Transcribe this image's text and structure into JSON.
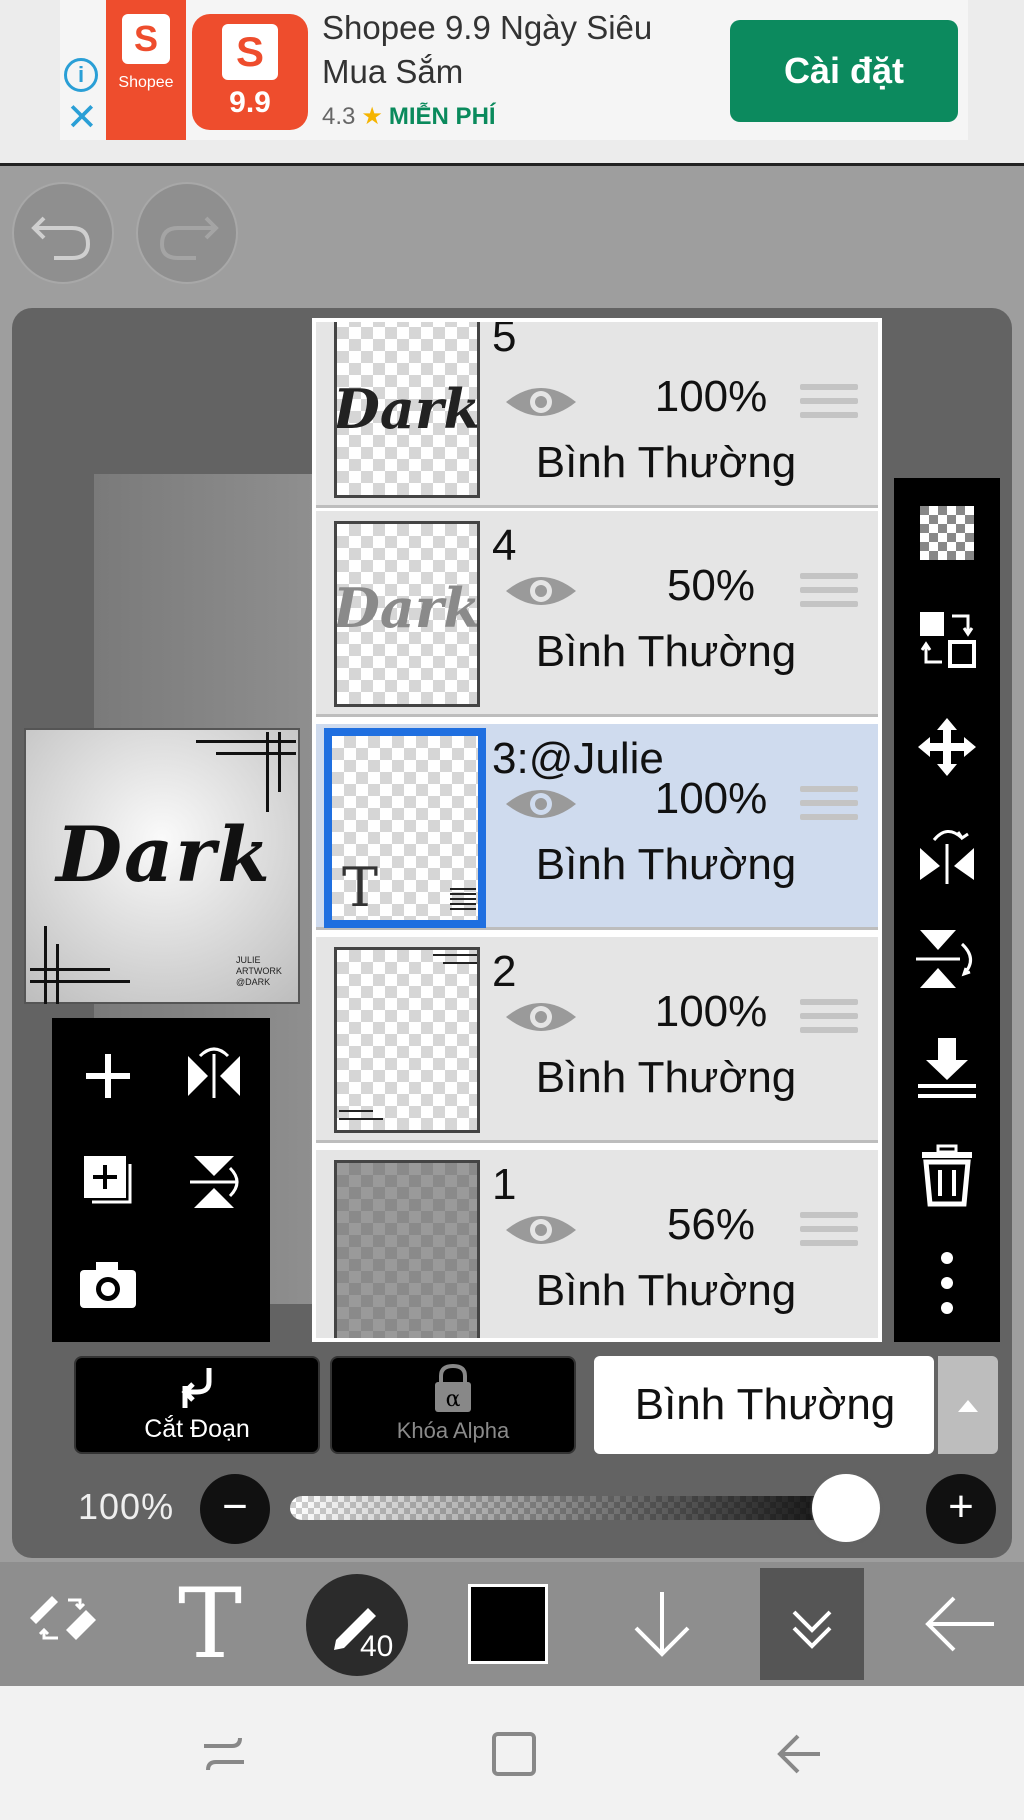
{
  "ad": {
    "app_logo_text": "Shopee",
    "sale_badge": "9.9",
    "title": "Shopee 9.9 Ngày Siêu Mua Sắm",
    "rating": "4.3",
    "price": "MIỄN PHÍ",
    "install_label": "Cài đặt"
  },
  "preview": {
    "art_text": "Dark",
    "credit_lines": [
      "JULIE",
      "ARTWORK",
      "@DARK"
    ]
  },
  "layers": [
    {
      "name": "5",
      "opacity": "100%",
      "blend": "Bình Thường",
      "selected": false,
      "thumb": "Dark"
    },
    {
      "name": "4",
      "opacity": "50%",
      "blend": "Bình Thường",
      "selected": false,
      "thumb": "Dark"
    },
    {
      "name": "3:@Julie",
      "opacity": "100%",
      "blend": "Bình Thường",
      "selected": true,
      "thumb": "T"
    },
    {
      "name": "2",
      "opacity": "100%",
      "blend": "Bình Thường",
      "selected": false,
      "thumb": ""
    },
    {
      "name": "1",
      "opacity": "56%",
      "blend": "Bình Thường",
      "selected": false,
      "thumb": ""
    }
  ],
  "controls": {
    "clipping_label": "Cắt Đoạn",
    "alpha_lock_label": "Khóa Alpha",
    "blend_mode": "Bình Thường",
    "opacity_label": "100%",
    "opacity_value": 1.0
  },
  "toolbar": {
    "brush_size": "40",
    "color": "#000000"
  },
  "icons": {
    "undo": "undo-icon",
    "redo": "redo-icon",
    "right_tools": [
      "transparency-icon",
      "swap-layer-icon",
      "move-icon",
      "flip-horizontal-icon",
      "flip-vertical-icon",
      "merge-down-icon",
      "trash-icon",
      "more-icon"
    ],
    "left_tools": [
      "add-layer-icon",
      "flip-horizontal-icon",
      "add-copy-icon",
      "flip-vertical-icon",
      "camera-icon"
    ]
  }
}
